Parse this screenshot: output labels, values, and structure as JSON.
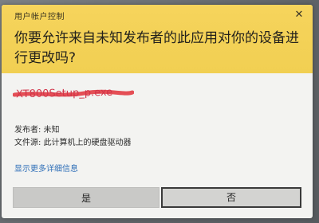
{
  "dialog": {
    "title": "用户帐户控制",
    "question": "你要允许来自未知发布者的此应用对你的设备进行更改吗?",
    "program_name": "XT800Setup_p.exe",
    "publisher_line": "发布者: 未知",
    "origin_line": "文件源: 此计算机上的硬盘驱动器",
    "more_details_link": "显示更多详细信息",
    "yes_button": "是",
    "no_button": "否",
    "close_glyph": "✕"
  },
  "colors": {
    "header_yellow": "#f3d257",
    "link_blue": "#2f6fb8",
    "program_name_red": "#d2354a"
  }
}
